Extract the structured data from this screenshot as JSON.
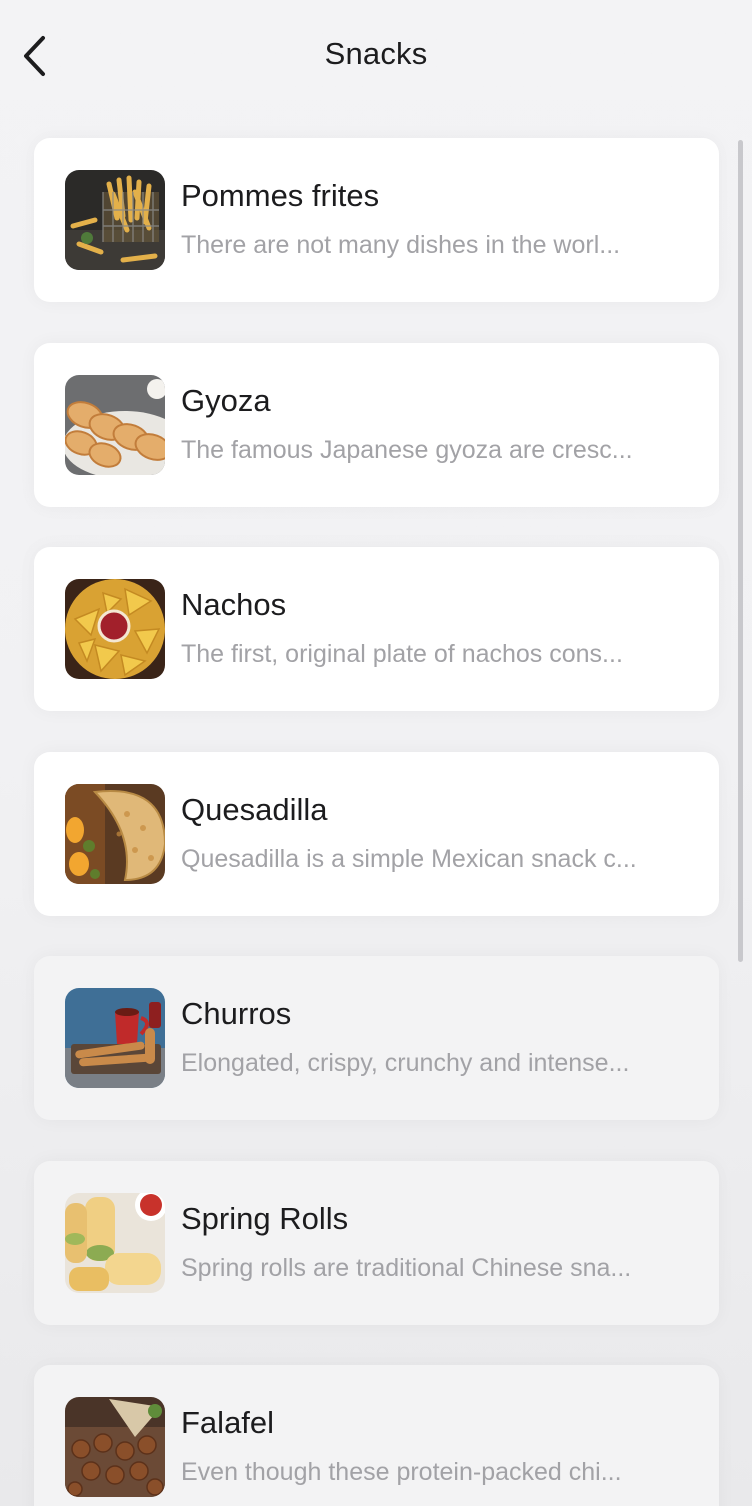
{
  "header": {
    "title": "Snacks",
    "back_icon": "chevron-left-icon"
  },
  "items": [
    {
      "title": "Pommes frites",
      "description": "There are not many dishes in the worl..."
    },
    {
      "title": "Gyoza",
      "description": "The famous Japanese gyoza are cresc..."
    },
    {
      "title": "Nachos",
      "description": "The first, original plate of nachos cons..."
    },
    {
      "title": "Quesadilla",
      "description": "Quesadilla is a simple Mexican snack c..."
    },
    {
      "title": "Churros",
      "description": "Elongated, crispy, crunchy and intense..."
    },
    {
      "title": "Spring Rolls",
      "description": "Spring rolls are traditional Chinese sna..."
    },
    {
      "title": "Falafel",
      "description": "Even though these protein-packed chi..."
    }
  ]
}
